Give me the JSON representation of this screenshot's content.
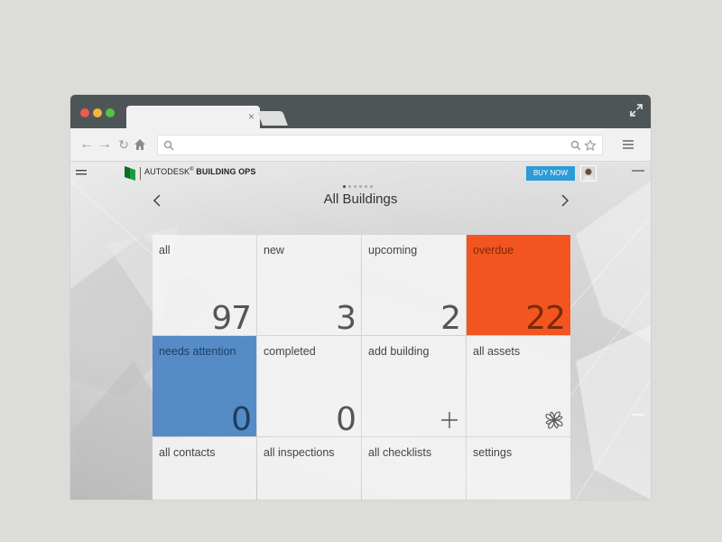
{
  "browser": {
    "tab_close": "×",
    "url_value": "",
    "url_placeholder": ""
  },
  "app": {
    "brand_prefix": "AUTODESK",
    "brand_reg": "®",
    "brand_product": "BUILDING OPS",
    "buy_now": "BUY NOW",
    "page_title": "All Buildings",
    "pager": {
      "current": 1,
      "total": 6
    }
  },
  "tiles": [
    {
      "label": "all",
      "value": "97"
    },
    {
      "label": "new",
      "value": "3"
    },
    {
      "label": "upcoming",
      "value": "2"
    },
    {
      "label": "overdue",
      "value": "22"
    },
    {
      "label": "needs attention",
      "value": "0"
    },
    {
      "label": "completed",
      "value": "0"
    },
    {
      "label": "add building",
      "icon": "plus-icon"
    },
    {
      "label": "all assets",
      "icon": "pinwheel-icon"
    },
    {
      "label": "all contacts"
    },
    {
      "label": "all inspections"
    },
    {
      "label": "all checklists"
    },
    {
      "label": "settings"
    }
  ],
  "colors": {
    "overdue": "#f25520",
    "needs_attention": "#4a85c4",
    "buy_button": "#2d9bd6",
    "titlebar": "#4d5557"
  }
}
